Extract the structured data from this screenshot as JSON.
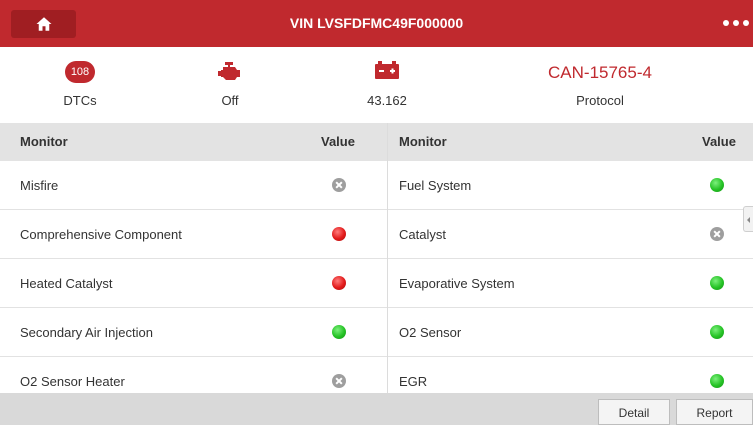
{
  "header": {
    "title": "VIN LVSFDFMC49F000000",
    "home_icon": "home-icon",
    "more_icon": "more-dots-icon"
  },
  "summary": {
    "dtc_count": "108",
    "dtc_label": "DTCs",
    "engine_icon": "engine-icon",
    "engine_value": "Off",
    "battery_icon": "battery-icon",
    "battery_value": "43.162",
    "protocol_value": "CAN-15765-4",
    "protocol_label": "Protocol"
  },
  "table": {
    "headers": {
      "monitor_left": "Monitor",
      "value_left": "Value",
      "monitor_right": "Monitor",
      "value_right": "Value"
    },
    "rows": [
      {
        "left": {
          "name": "Misfire",
          "status": "not-supported"
        },
        "right": {
          "name": "Fuel System",
          "status": "complete"
        }
      },
      {
        "left": {
          "name": "Comprehensive Component",
          "status": "incomplete"
        },
        "right": {
          "name": "Catalyst",
          "status": "not-supported"
        }
      },
      {
        "left": {
          "name": "Heated Catalyst",
          "status": "incomplete"
        },
        "right": {
          "name": "Evaporative System",
          "status": "complete"
        }
      },
      {
        "left": {
          "name": "Secondary Air Injection",
          "status": "complete"
        },
        "right": {
          "name": "O2 Sensor",
          "status": "complete"
        }
      },
      {
        "left": {
          "name": "O2 Sensor Heater",
          "status": "not-supported"
        },
        "right": {
          "name": "EGR",
          "status": "complete"
        }
      }
    ]
  },
  "status_colors": {
    "complete": "#25c225",
    "incomplete": "#e21a1a",
    "not-supported": "#9e9e9e"
  },
  "accent_color": "#c0292e",
  "footer": {
    "detail_label": "Detail",
    "report_label": "Report"
  }
}
